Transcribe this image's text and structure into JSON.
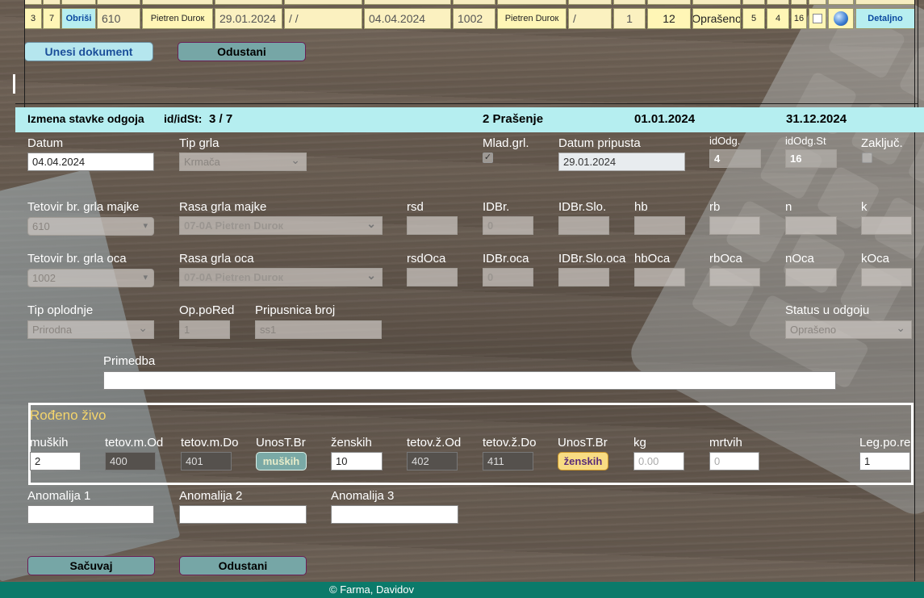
{
  "top_row": {
    "cells": [
      "3",
      "7",
      "Obriši",
      "610",
      "Pietren Duroк",
      "29.01.2024",
      " / /",
      "04.04.2024",
      "1002",
      "Pietren Duroк",
      " /",
      "1",
      "12",
      "Oprašeno",
      "5",
      "4",
      "16",
      "",
      "",
      "Detaljno"
    ]
  },
  "buttons": {
    "unesi": "Unesi dokument",
    "odustani": "Odustani",
    "sacuvaj": "Sačuvaj",
    "odustani2": "Odustani"
  },
  "header": {
    "title": "Izmena stavke  odgoja",
    "id_label": "id/idSt:",
    "id_value": "3 / 7",
    "phase": "2 Prašenje",
    "date_from": "01.01.2024",
    "date_to": "31.12.2024"
  },
  "row1": {
    "datum_label": "Datum",
    "datum_value": "04.04.2024",
    "tip_grla_label": "Tip grla",
    "tip_grla_value": "Krmača",
    "mlad_label": "Mlad.grl.",
    "datum_pripusta_label": "Datum pripusta",
    "datum_pripusta_value": "29.01.2024",
    "idodg_label": "idOdg.",
    "idodg_value": "4",
    "idodgst_label": "idOdg.St",
    "idodgst_value": "16",
    "zakljuc_label": "Zaključ."
  },
  "row2": {
    "tetovir_majke_label": "Tetovir br. grla majke",
    "tetovir_majke_value": "610",
    "rasa_majke_label": "Rasa grla majke",
    "rasa_majke_value": "07-0A Pietren Duroк",
    "rsd_label": "rsd",
    "idbr_label": "IDBr.",
    "idbr_value": "0",
    "idbrslo_label": "IDBr.Slo.",
    "hb_label": "hb",
    "rb_label": "rb",
    "n_label": "n",
    "k_label": "k"
  },
  "row3": {
    "tetovir_oca_label": "Tetovir br. grla oca",
    "tetovir_oca_value": "1002",
    "rasa_oca_label": "Rasa grla oca",
    "rasa_oca_value": "07-0A Pietren Duroк",
    "rsdoca_label": "rsdOca",
    "idbroca_label": "IDBr.oca",
    "idbroca_value": "0",
    "idbrslooca_label": "IDBr.Slo.oca",
    "hboca_label": "hbOca",
    "rboca_label": "rbOca",
    "noca_label": "nOca",
    "koca_label": "kOca"
  },
  "row4": {
    "tip_oplodnje_label": "Tip oplodnje",
    "tip_oplodnje_value": "Prirodna",
    "opored_label": "Op.poRed",
    "opored_value": "1",
    "pripusnica_label": "Pripusnica broj",
    "pripusnica_value": "ss1",
    "status_label": "Status u odgoju",
    "status_value": "Oprašeno"
  },
  "primedba_label": "Primedba",
  "rodeno": {
    "title": "Rođeno živo",
    "muskih_label": "muških",
    "muskih_value": "2",
    "tetov_m_od_label": "tetov.m.Od",
    "tetov_m_od_value": "400",
    "tetov_m_do_label": "tetov.m.Do",
    "tetov_m_do_value": "401",
    "unos_m_label": "UnosT.Br",
    "unos_m_button": "muških",
    "zenskih_label": "ženskih",
    "zenskih_value": "10",
    "tetov_z_od_label": "tetov.ž.Od",
    "tetov_z_od_value": "402",
    "tetov_z_do_label": "tetov.ž.Do",
    "tetov_z_do_value": "411",
    "unos_z_label": "UnosT.Br",
    "unos_z_button": "ženskih",
    "kg_label": "kg",
    "kg_placeholder": "0.00",
    "mrtvih_label": "mrtvih",
    "mrtvih_placeholder": "0",
    "leg_label": "Leg.po.re",
    "leg_value": "1"
  },
  "anomalije": {
    "a1": "Anomalija 1",
    "a2": "Anomalija 2",
    "a3": "Anomalija 3"
  },
  "footer": "© Farma, Davidov"
}
